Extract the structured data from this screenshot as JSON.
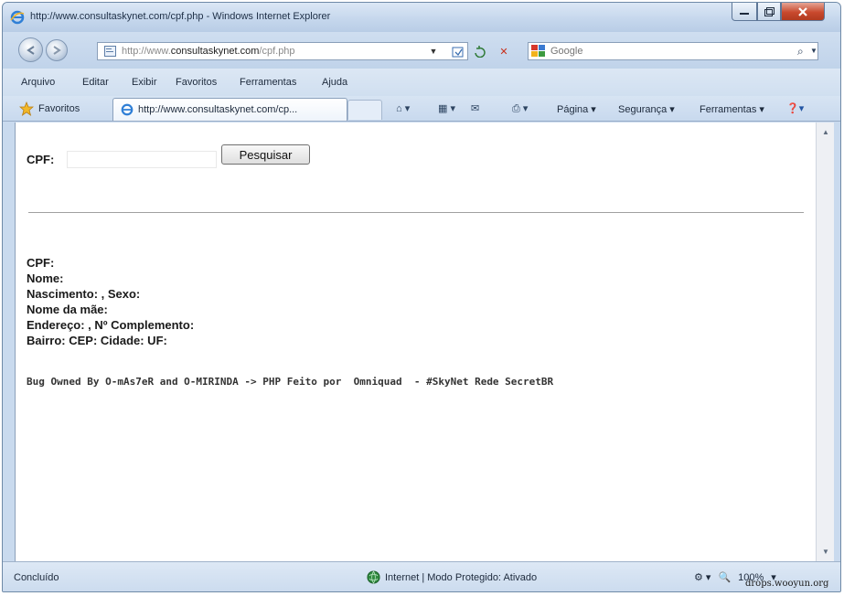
{
  "window": {
    "title": "http://www.consultaskynet.com/cpf.php - Windows Internet Explorer"
  },
  "address": {
    "url_prefix": "http://www.",
    "url_domain": "consultaskynet.com",
    "url_path": "/cpf.php"
  },
  "search": {
    "placeholder": "Google",
    "go_icon": "search-icon"
  },
  "menu": {
    "items": [
      "Arquivo",
      "Editar",
      "Exibir",
      "Favoritos",
      "Ferramentas",
      "Ajuda"
    ]
  },
  "favorites_bar": {
    "favorites_label": "Favoritos",
    "tab_title": "http://www.consultaskynet.com/cp...",
    "commands": {
      "pagina": "Página ▾",
      "seguranca": "Segurança ▾",
      "ferramentas": "Ferramentas ▾"
    }
  },
  "page": {
    "cpf_label": "CPF:",
    "cpf_value": "",
    "search_button": "Pesquisar",
    "results": [
      "CPF:",
      "Nome:",
      "Nascimento: , Sexo:",
      "Nome da mãe:",
      "Endereço: , Nº Complemento:",
      "Bairro: CEP: Cidade: UF:"
    ],
    "owned_line": "Bug Owned By O-mAs7eR and O-MIRINDA -> PHP Feito por  Omniquad  - #SkyNet Rede SecretBR"
  },
  "status": {
    "text": "Concluído",
    "zone": "Internet | Modo Protegido: Ativado",
    "zoom": "100%"
  },
  "watermark": "drops.wooyun.org",
  "colors": {
    "chrome": "#c9daee",
    "close_button": "#c94a2e"
  }
}
